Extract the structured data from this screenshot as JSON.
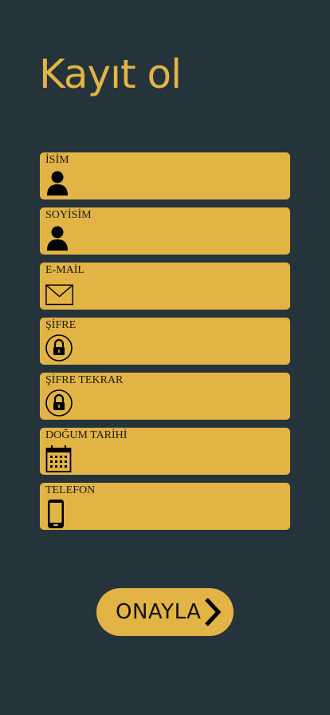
{
  "page": {
    "title": "Kayıt ol"
  },
  "form": {
    "fields": [
      {
        "label": "İSİM",
        "icon": "person-icon",
        "value": "",
        "placeholder": ""
      },
      {
        "label": "SOYİSİM",
        "icon": "person-icon",
        "value": "",
        "placeholder": ""
      },
      {
        "label": "E-MAİL",
        "icon": "envelope-icon",
        "value": "",
        "placeholder": ""
      },
      {
        "label": "ŞİFRE",
        "icon": "lock-icon",
        "value": "",
        "placeholder": ""
      },
      {
        "label": "ŞİFRE TEKRAR",
        "icon": "lock-icon",
        "value": "",
        "placeholder": ""
      },
      {
        "label": "DOĞUM TARİHİ",
        "icon": "calendar-icon",
        "value": "",
        "placeholder": ""
      },
      {
        "label": "TELEFON",
        "icon": "phone-icon",
        "value": "",
        "placeholder": ""
      }
    ],
    "submit_label": "ONAYLA",
    "submit_icon": "chevron-right-icon"
  },
  "colors": {
    "background": "#25333a",
    "accent": "#e2b446",
    "text_dark": "#111111"
  }
}
